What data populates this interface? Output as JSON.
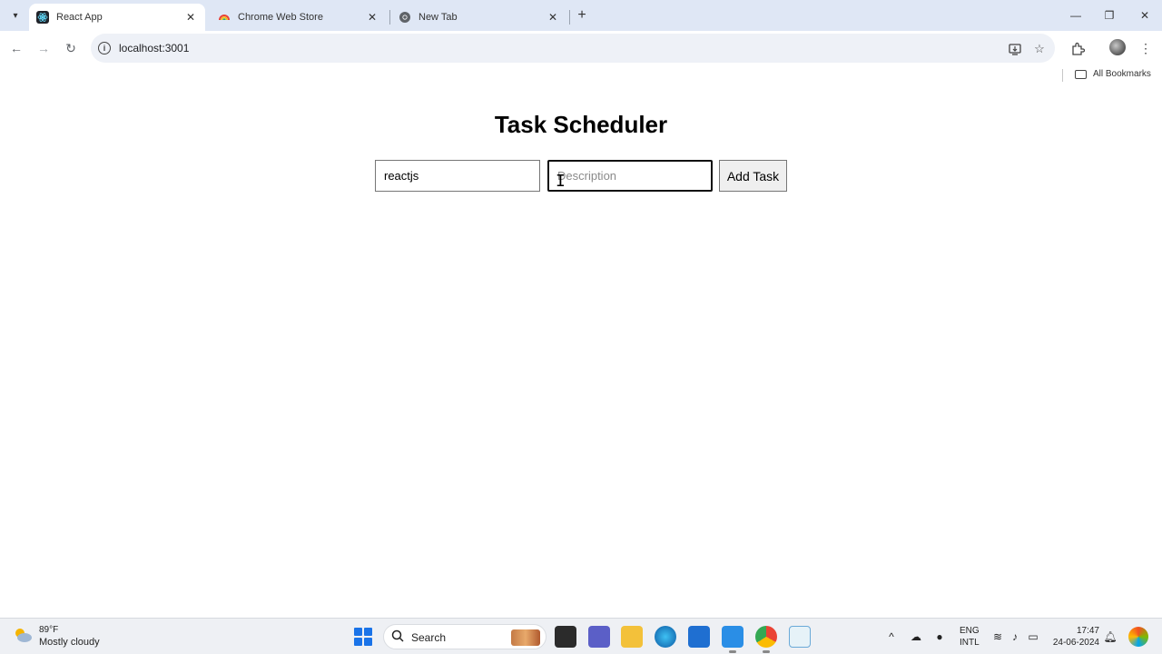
{
  "browser": {
    "tabs": [
      {
        "label": "React App",
        "active": true
      },
      {
        "label": "Chrome Web Store",
        "active": false
      },
      {
        "label": "New Tab",
        "active": false
      }
    ],
    "url": "localhost:3001",
    "bookmarks_label": "All Bookmarks"
  },
  "app": {
    "title": "Task Scheduler",
    "task_name_value": "reactjs",
    "description_placeholder": "Description",
    "add_button_label": "Add Task"
  },
  "taskbar": {
    "weather_temp": "89°F",
    "weather_desc": "Mostly cloudy",
    "search_label": "Search",
    "lang_line1": "ENG",
    "lang_line2": "INTL",
    "time": "17:47",
    "date": "24-06-2024"
  },
  "colors": {
    "tabstrip_bg": "#dfe7f5",
    "omnibox_bg": "#eef1f7",
    "taskbar_bg": "#eef0f4",
    "windows_blue": "#1a73e8"
  }
}
